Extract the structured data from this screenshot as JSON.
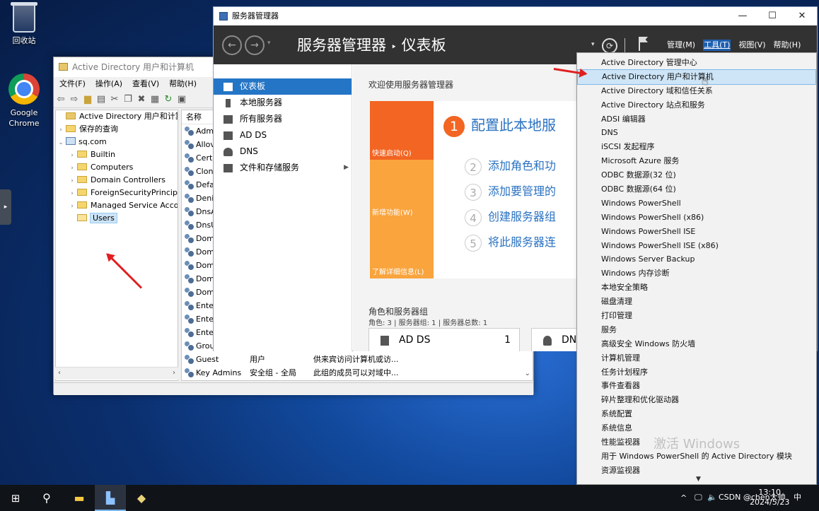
{
  "desktop": {
    "icons": [
      {
        "label": "回收站",
        "icon": "recycle-bin-icon"
      },
      {
        "label": "Google\nChrome",
        "icon": "chrome-icon"
      }
    ],
    "watermark": "激活 Windows"
  },
  "ad_window": {
    "title": "Active Directory 用户和计算机",
    "menu": [
      "文件(F)",
      "操作(A)",
      "查看(V)",
      "帮助(H)"
    ],
    "tree": {
      "root": "Active Directory 用户和计算机",
      "saved": "保存的查询",
      "domain": "sq.com",
      "children": [
        "Builtin",
        "Computers",
        "Domain Controllers",
        "ForeignSecurityPrincipals",
        "Managed Service Accounts",
        "Users"
      ]
    },
    "list": {
      "header": "名称",
      "rows": [
        {
          "name": "Adm",
          "type": "",
          "desc": ""
        },
        {
          "name": "Allov",
          "type": "",
          "desc": ""
        },
        {
          "name": "Cert",
          "type": "",
          "desc": ""
        },
        {
          "name": "Clone",
          "type": "",
          "desc": ""
        },
        {
          "name": "Defa",
          "type": "",
          "desc": ""
        },
        {
          "name": "Deni",
          "type": "",
          "desc": ""
        },
        {
          "name": "DnsA",
          "type": "",
          "desc": ""
        },
        {
          "name": "DnsU",
          "type": "",
          "desc": ""
        },
        {
          "name": "Dom",
          "type": "",
          "desc": ""
        },
        {
          "name": "Dom",
          "type": "",
          "desc": ""
        },
        {
          "name": "Dom",
          "type": "",
          "desc": ""
        },
        {
          "name": "Dom",
          "type": "",
          "desc": ""
        },
        {
          "name": "Dom",
          "type": "",
          "desc": ""
        },
        {
          "name": "Enter",
          "type": "",
          "desc": ""
        },
        {
          "name": "Enter",
          "type": "",
          "desc": ""
        },
        {
          "name": "Enter",
          "type": "",
          "desc": ""
        },
        {
          "name": "Grou",
          "type": "",
          "desc": ""
        },
        {
          "name": "Guest",
          "type": "用户",
          "desc": "供来宾访问计算机或访..."
        },
        {
          "name": "Key Admins",
          "type": "安全组 - 全局",
          "desc": "此组的成员可以对域中..."
        }
      ]
    }
  },
  "server_manager": {
    "title": "服务器管理器",
    "heading_app": "服务器管理器",
    "heading_sep": "‣",
    "heading_page": "仪表板",
    "menu": {
      "manage": "管理(M)",
      "tools": "工具(T)",
      "view": "视图(V)",
      "help": "帮助(H)"
    },
    "nav": [
      "仪表板",
      "本地服务器",
      "所有服务器",
      "AD DS",
      "DNS",
      "文件和存储服务"
    ],
    "welcome": "欢迎使用服务器管理器",
    "tiles": [
      "快速启动(Q)",
      "新增功能(W)",
      "了解详细信息(L)"
    ],
    "steps": [
      {
        "n": "1",
        "text": "配置此本地服"
      },
      {
        "n": "2",
        "text": "添加角色和功"
      },
      {
        "n": "3",
        "text": "添加要管理的"
      },
      {
        "n": "4",
        "text": "创建服务器组"
      },
      {
        "n": "5",
        "text": "将此服务器连"
      }
    ],
    "roles_title": "角色和服务器组",
    "roles_sub": "角色: 3 | 服务器组: 1 | 服务器总数: 1",
    "cards": [
      {
        "name": "AD DS",
        "count": "1"
      },
      {
        "name": "DN",
        "count": ""
      }
    ],
    "window_controls": {
      "min": "—",
      "max": "☐",
      "close": "✕"
    }
  },
  "tools_menu": {
    "items": [
      "Active Directory 管理中心",
      "Active Directory 用户和计算机",
      "Active Directory 域和信任关系",
      "Active Directory 站点和服务",
      "ADSI 编辑器",
      "DNS",
      "iSCSI 发起程序",
      "Microsoft Azure 服务",
      "ODBC 数据源(32 位)",
      "ODBC 数据源(64 位)",
      "Windows PowerShell",
      "Windows PowerShell (x86)",
      "Windows PowerShell ISE",
      "Windows PowerShell ISE (x86)",
      "Windows Server Backup",
      "Windows 内存诊断",
      "本地安全策略",
      "磁盘清理",
      "打印管理",
      "服务",
      "高级安全 Windows 防火墙",
      "计算机管理",
      "任务计划程序",
      "事件查看器",
      "碎片整理和优化驱动器",
      "系统配置",
      "系统信息",
      "性能监视器",
      "用于 Windows PowerShell 的 Active Directory 模块",
      "资源监视器"
    ],
    "highlighted_index": 1
  },
  "taskbar": {
    "time": "13:10",
    "date": "2024/5/23",
    "tray_text": "CSDN @chen大帅",
    "ime": "中",
    "chevron": "^"
  }
}
